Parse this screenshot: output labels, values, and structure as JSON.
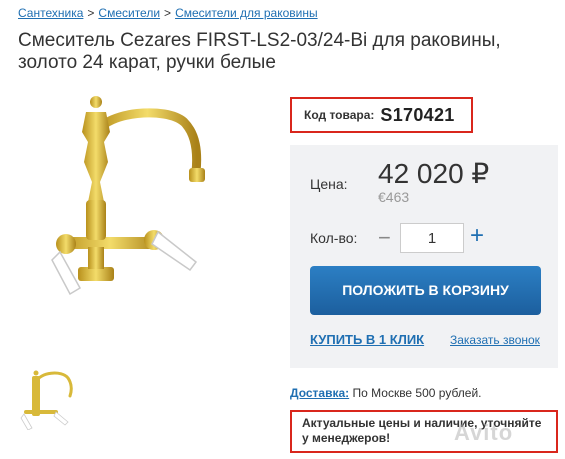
{
  "breadcrumbs": [
    "Сантехника",
    "Смесители",
    "Смесители для раковины"
  ],
  "breadcrumb_separator": ">",
  "title": "Смеситель Cezares FIRST-LS2-03/24-Bi для раковины, золото 24 карат, ручки белые",
  "product_code": {
    "label": "Код товара:",
    "value": "S170421"
  },
  "price": {
    "label": "Цена:",
    "main": "42 020 ₽",
    "alt": "€463"
  },
  "quantity": {
    "label": "Кол-во:",
    "minus": "−",
    "value": "1",
    "plus": "+"
  },
  "buttons": {
    "add_to_cart": "ПОЛОЖИТЬ В КОРЗИНУ",
    "one_click": "КУПИТЬ В 1 КЛИК",
    "callback": "Заказать звонок"
  },
  "delivery": {
    "link": "Доставка:",
    "text": "По Москве 500 рублей."
  },
  "notice": "Актуальные цены и наличие, уточняйте у менеджеров!",
  "watermark": "Avito",
  "colors": {
    "accent": "#1f6fb2",
    "highlight_border": "#d9261c",
    "panel_bg": "#f1f2f4",
    "gold": "#d8b93a"
  },
  "icons": [
    "faucet-product-image",
    "faucet-thumbnail-image"
  ]
}
